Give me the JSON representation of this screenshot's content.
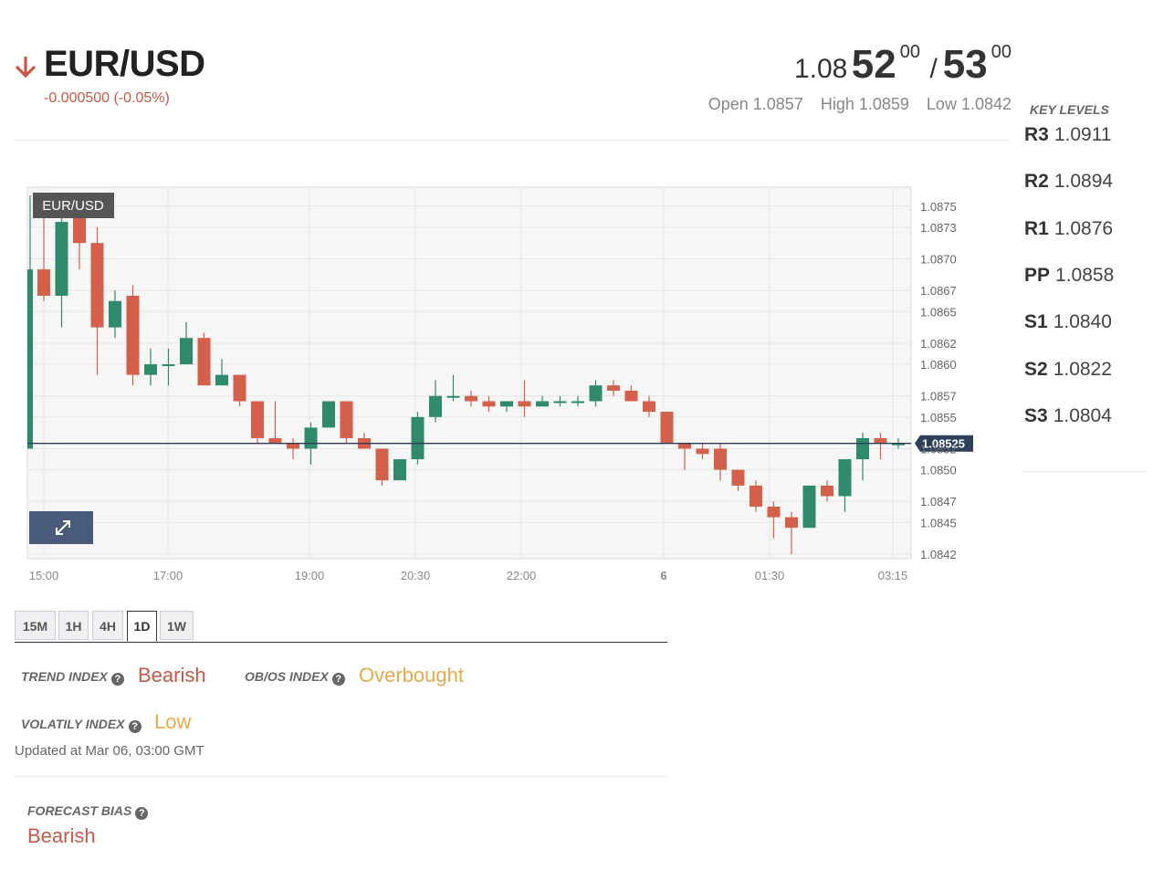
{
  "header": {
    "pair": "EUR/USD",
    "change": "-0.000500 (-0.05%)",
    "direction_icon": "arrow-down-icon",
    "down_color": "#c95846"
  },
  "quote": {
    "bid_prefix": "1.08",
    "bid_big": "52",
    "bid_sup": "00",
    "separator": "/",
    "ask_big": "53",
    "ask_sup": "00"
  },
  "ohl": {
    "open": "Open 1.0857",
    "high": "High 1.0859",
    "low": "Low 1.0842"
  },
  "key_levels": {
    "title": "KEY LEVELS",
    "levels": [
      {
        "name": "R3",
        "value": "1.0911"
      },
      {
        "name": "R2",
        "value": "1.0894"
      },
      {
        "name": "R1",
        "value": "1.0876"
      },
      {
        "name": "PP",
        "value": "1.0858"
      },
      {
        "name": "S1",
        "value": "1.0840"
      },
      {
        "name": "S2",
        "value": "1.0822"
      },
      {
        "name": "S3",
        "value": "1.0804"
      }
    ]
  },
  "chart_data": {
    "type": "candlestick",
    "legend_label": "EUR/USD",
    "current_price": 1.08525,
    "current_price_label": "1.08525",
    "y_ticks": [
      "1.0875",
      "1.0873",
      "1.0870",
      "1.0867",
      "1.0865",
      "1.0862",
      "1.0860",
      "1.0857",
      "1.0855",
      "1.0852",
      "1.0850",
      "1.0847",
      "1.0845",
      "1.0842"
    ],
    "x_ticks": [
      "15:00",
      "17:00",
      "19:00",
      "20:30",
      "22:00",
      "6",
      "01:30",
      "03:15"
    ],
    "ylim": [
      1.0842,
      1.0876
    ],
    "up_color": "#2f8a6c",
    "down_color": "#d45f4a",
    "candles": [
      {
        "o": 1.0852,
        "h": 1.0876,
        "l": 1.0852,
        "c": 1.0869
      },
      {
        "o": 1.0869,
        "h": 1.0874,
        "l": 1.0866,
        "c": 1.08665
      },
      {
        "o": 1.08665,
        "h": 1.0874,
        "l": 1.08635,
        "c": 1.08735
      },
      {
        "o": 1.0874,
        "h": 1.0876,
        "l": 1.0869,
        "c": 1.08715
      },
      {
        "o": 1.08715,
        "h": 1.0873,
        "l": 1.0859,
        "c": 1.08635
      },
      {
        "o": 1.08635,
        "h": 1.0867,
        "l": 1.08625,
        "c": 1.0866
      },
      {
        "o": 1.08665,
        "h": 1.08675,
        "l": 1.0858,
        "c": 1.0859
      },
      {
        "o": 1.0859,
        "h": 1.08615,
        "l": 1.0858,
        "c": 1.086
      },
      {
        "o": 1.086,
        "h": 1.08615,
        "l": 1.0858,
        "c": 1.086
      },
      {
        "o": 1.086,
        "h": 1.0864,
        "l": 1.086,
        "c": 1.08625
      },
      {
        "o": 1.08625,
        "h": 1.0863,
        "l": 1.0858,
        "c": 1.0858
      },
      {
        "o": 1.0858,
        "h": 1.08605,
        "l": 1.0858,
        "c": 1.0859
      },
      {
        "o": 1.0859,
        "h": 1.0859,
        "l": 1.0856,
        "c": 1.08565
      },
      {
        "o": 1.08565,
        "h": 1.08565,
        "l": 1.08525,
        "c": 1.0853
      },
      {
        "o": 1.0853,
        "h": 1.08565,
        "l": 1.08525,
        "c": 1.08525
      },
      {
        "o": 1.08525,
        "h": 1.0853,
        "l": 1.0851,
        "c": 1.0852
      },
      {
        "o": 1.0852,
        "h": 1.08545,
        "l": 1.08505,
        "c": 1.0854
      },
      {
        "o": 1.0854,
        "h": 1.08565,
        "l": 1.0854,
        "c": 1.08565
      },
      {
        "o": 1.08565,
        "h": 1.08565,
        "l": 1.08525,
        "c": 1.0853
      },
      {
        "o": 1.0853,
        "h": 1.08535,
        "l": 1.0852,
        "c": 1.0852
      },
      {
        "o": 1.0852,
        "h": 1.0852,
        "l": 1.08485,
        "c": 1.0849
      },
      {
        "o": 1.0849,
        "h": 1.0851,
        "l": 1.0849,
        "c": 1.0851
      },
      {
        "o": 1.0851,
        "h": 1.08555,
        "l": 1.08505,
        "c": 1.0855
      },
      {
        "o": 1.0855,
        "h": 1.08585,
        "l": 1.08545,
        "c": 1.0857
      },
      {
        "o": 1.0857,
        "h": 1.0859,
        "l": 1.08565,
        "c": 1.0857
      },
      {
        "o": 1.0857,
        "h": 1.08575,
        "l": 1.0856,
        "c": 1.08565
      },
      {
        "o": 1.08565,
        "h": 1.0857,
        "l": 1.08555,
        "c": 1.0856
      },
      {
        "o": 1.0856,
        "h": 1.08565,
        "l": 1.08555,
        "c": 1.08565
      },
      {
        "o": 1.08565,
        "h": 1.08585,
        "l": 1.0855,
        "c": 1.0856
      },
      {
        "o": 1.0856,
        "h": 1.0857,
        "l": 1.0856,
        "c": 1.08565
      },
      {
        "o": 1.08565,
        "h": 1.0857,
        "l": 1.0856,
        "c": 1.08565
      },
      {
        "o": 1.08565,
        "h": 1.0857,
        "l": 1.0856,
        "c": 1.08565
      },
      {
        "o": 1.08565,
        "h": 1.08585,
        "l": 1.0856,
        "c": 1.0858
      },
      {
        "o": 1.0858,
        "h": 1.08585,
        "l": 1.0857,
        "c": 1.08575
      },
      {
        "o": 1.08575,
        "h": 1.0858,
        "l": 1.08565,
        "c": 1.08565
      },
      {
        "o": 1.08565,
        "h": 1.0857,
        "l": 1.0855,
        "c": 1.08555
      },
      {
        "o": 1.08555,
        "h": 1.08555,
        "l": 1.08525,
        "c": 1.08525
      },
      {
        "o": 1.08525,
        "h": 1.08525,
        "l": 1.085,
        "c": 1.0852
      },
      {
        "o": 1.0852,
        "h": 1.08525,
        "l": 1.0851,
        "c": 1.08515
      },
      {
        "o": 1.0852,
        "h": 1.08525,
        "l": 1.0849,
        "c": 1.085
      },
      {
        "o": 1.085,
        "h": 1.085,
        "l": 1.0848,
        "c": 1.08485
      },
      {
        "o": 1.08485,
        "h": 1.0849,
        "l": 1.0846,
        "c": 1.08465
      },
      {
        "o": 1.08465,
        "h": 1.0847,
        "l": 1.08435,
        "c": 1.08455
      },
      {
        "o": 1.08455,
        "h": 1.0846,
        "l": 1.0842,
        "c": 1.08445
      },
      {
        "o": 1.08445,
        "h": 1.08485,
        "l": 1.08445,
        "c": 1.08485
      },
      {
        "o": 1.08485,
        "h": 1.0849,
        "l": 1.0847,
        "c": 1.08475
      },
      {
        "o": 1.08475,
        "h": 1.0851,
        "l": 1.0846,
        "c": 1.0851
      },
      {
        "o": 1.0851,
        "h": 1.08535,
        "l": 1.0849,
        "c": 1.0853
      },
      {
        "o": 1.0853,
        "h": 1.08535,
        "l": 1.0851,
        "c": 1.08525
      },
      {
        "o": 1.08525,
        "h": 1.0853,
        "l": 1.0852,
        "c": 1.08525
      }
    ],
    "grid": true
  },
  "timeframes": {
    "items": [
      "15M",
      "1H",
      "4H",
      "1D",
      "1W"
    ],
    "active": "1D"
  },
  "indices": {
    "trend_label": "TREND INDEX",
    "trend_value": "Bearish",
    "obos_label": "OB/OS INDEX",
    "obos_value": "Overbought",
    "vol_label": "VOLATILY INDEX",
    "vol_value": "Low",
    "help_glyph": "?",
    "updated": "Updated at Mar 06, 03:00 GMT"
  },
  "forecast": {
    "label": "FORECAST BIAS",
    "value": "Bearish"
  }
}
